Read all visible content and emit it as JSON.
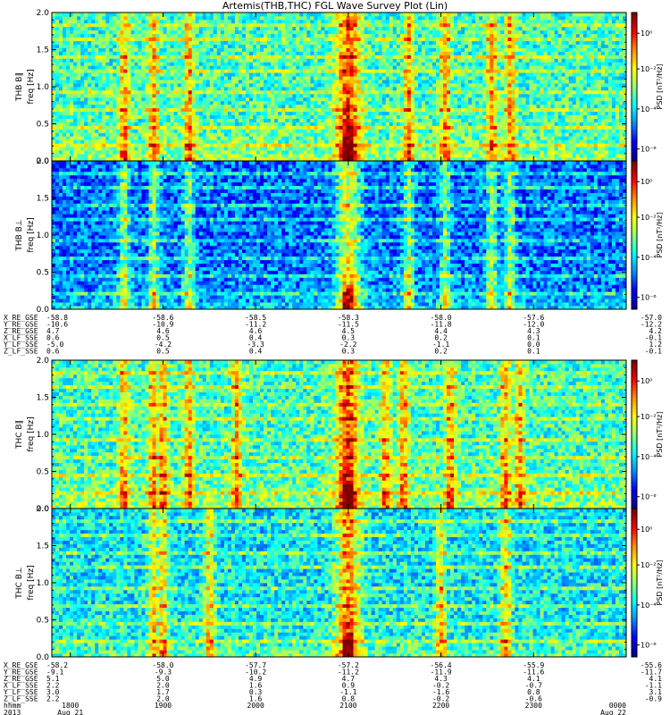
{
  "title": "Artemis(THB,THC) FGL Wave Survey Plot (Lin)",
  "colors": {
    "background": "#ffffff",
    "panel_frame": "#000000"
  },
  "chart_data": {
    "type": "heatmap",
    "xlabel": "",
    "ylabel": "freq [Hz]",
    "ylim": [
      0,
      2.0
    ],
    "yticks": [
      "0.0",
      "0.5",
      "1.0",
      "1.5",
      "2.0"
    ],
    "colorbar_label": "PSD [nT²/Hz]",
    "colorbar_ticks": [
      "10⁻⁶",
      "10⁻⁴",
      "10⁻²",
      "10⁰"
    ],
    "colorscale": [
      "#000090",
      "#0000ff",
      "#0090ff",
      "#00ffff",
      "#90ff70",
      "#ffff00",
      "#ff9000",
      "#ff0000",
      "#800000"
    ],
    "panels": [
      {
        "probe": "THB",
        "component": "B∥",
        "label": "THB B∥",
        "activity_hours_utc": [
          18.58,
          18.9,
          19.28,
          21.0,
          21.65,
          22.05,
          22.55,
          22.75
        ],
        "background_level": 0.42
      },
      {
        "probe": "THB",
        "component": "B⊥",
        "label": "THB B⊥",
        "activity_hours_utc": [
          18.58,
          18.9,
          19.28,
          21.0,
          21.65,
          22.05,
          22.55,
          22.75
        ],
        "background_level": 0.22
      },
      {
        "probe": "THC",
        "component": "B∥",
        "label": "THC B∥",
        "activity_hours_utc": [
          18.58,
          18.9,
          19.0,
          19.28,
          19.8,
          21.0,
          21.4,
          21.6,
          22.1,
          22.7,
          22.85
        ],
        "background_level": 0.42
      },
      {
        "probe": "THC",
        "component": "B⊥",
        "label": "THC B⊥",
        "activity_hours_utc": [
          18.9,
          19.0,
          19.5,
          21.0,
          22.0,
          22.7
        ],
        "background_level": 0.35
      }
    ],
    "positions": [
      {
        "probe": "THB",
        "rows": [
          {
            "name": "X_RE_GSE",
            "values": [
              "-58.8",
              "-58.6",
              "-58.5",
              "-58.3",
              "-58.0",
              "-57.6",
              "-57.0"
            ]
          },
          {
            "name": "Y_RE_GSE",
            "values": [
              "-10.6",
              "-10.9",
              "-11.2",
              "-11.5",
              "-11.8",
              "-12.0",
              "-12.2"
            ]
          },
          {
            "name": "Z_RE_GSE",
            "values": [
              "4.7",
              "4.6",
              "4.6",
              "4.5",
              "4.4",
              "4.3",
              "4.2"
            ]
          },
          {
            "name": "X_LF_SSE",
            "values": [
              "0.6",
              "0.5",
              "0.4",
              "0.3",
              "0.2",
              "0.1",
              "-0.1"
            ]
          },
          {
            "name": "Y_LF_SSE",
            "values": [
              "-5.0",
              "-4.2",
              "-3.3",
              "-2.2",
              "-1.1",
              "0.0",
              "1.2"
            ]
          },
          {
            "name": "Z_LF_SSE",
            "values": [
              "0.6",
              "0.5",
              "0.4",
              "0.3",
              "0.2",
              "0.1",
              "-0.1"
            ]
          }
        ]
      },
      {
        "probe": "THC",
        "rows": [
          {
            "name": "X_RE_GSE",
            "values": [
              "-58.2",
              "-58.0",
              "-57.7",
              "-57.2",
              "-56.4",
              "-55.9",
              "-55.6"
            ]
          },
          {
            "name": "Y_RE_GSE",
            "values": [
              "-9.1",
              "-9.3",
              "-10.2",
              "-11.2",
              "-11.9",
              "-11.6",
              "-11.7"
            ]
          },
          {
            "name": "Z_RE_GSE",
            "values": [
              "5.1",
              "5.0",
              "4.9",
              "4.7",
              "4.3",
              "4.1",
              "4.1"
            ]
          },
          {
            "name": "X_LF_SSE",
            "values": [
              "2.2",
              "2.0",
              "1.6",
              "0.9",
              "-0.2",
              "-0.7",
              "-1.1"
            ]
          },
          {
            "name": "Y_LF_SSE",
            "values": [
              "3.0",
              "1.7",
              "0.3",
              "-1.1",
              "-1.6",
              "0.8",
              "3.1"
            ]
          },
          {
            "name": "Z_LF_SSE",
            "values": [
              "2.2",
              "2.0",
              "1.6",
              "0.8",
              "-0.2",
              "-0.6",
              "-0.9"
            ]
          }
        ]
      }
    ],
    "time_axis": {
      "row_label_hhmm": "hhmm",
      "row_label_date": "2013",
      "hhmm": [
        "1800",
        "1900",
        "2000",
        "2100",
        "2200",
        "2300",
        "0000"
      ],
      "dates": {
        "first": "Aug 21",
        "last": "Aug 22"
      },
      "x_start_hour": 17.8,
      "x_end_hour": 24.0
    }
  }
}
